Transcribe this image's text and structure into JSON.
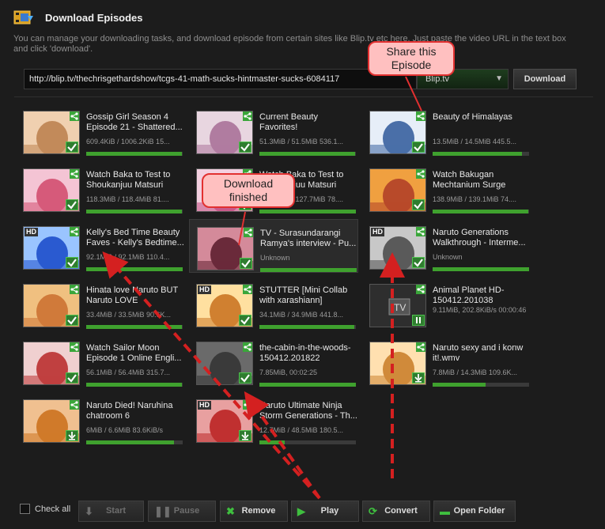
{
  "header": {
    "title": "Download Episodes",
    "description": "You can manage your downloading tasks, and download episode from certain sites like Blip.tv etc here. Just paste the video URL in the text box and click 'download'."
  },
  "url_bar": {
    "value": "http://blip.tv/thechrisgethardshow/tcgs-41-math-sucks-hintmaster-sucks-6084117",
    "site": "Blip.tv",
    "download_label": "Download"
  },
  "callouts": {
    "share": "Share this Episode",
    "finished": "Download finished"
  },
  "episodes": [
    {
      "title": "Gossip Girl Season 4 Episode 21 - Shattered...",
      "info": "609.4KiB / 1006.2KiB 15...",
      "progress": 0.99,
      "status": "finished",
      "hd": false
    },
    {
      "title": "Current Beauty Favorites!",
      "info": "51.3MiB / 51.5MiB 536.1...",
      "progress": 0.99,
      "status": "finished",
      "hd": false
    },
    {
      "title": "Beauty of Himalayas",
      "info": "13.5MiB / 14.5MiB 445.5...",
      "progress": 0.93,
      "status": "finished",
      "hd": false
    },
    {
      "title": "Watch Baka to Test to Shoukanjuu Matsuri Epi...",
      "info": "118.3MiB / 118.4MiB 81....",
      "progress": 0.99,
      "status": "finished",
      "hd": false
    },
    {
      "title": "Watch Baka to Test to Shoukanjuu Matsuri Epi...",
      "info": "127.7MiB / 127.7MiB 78....",
      "progress": 1.0,
      "status": "finished",
      "hd": false
    },
    {
      "title": "Watch Bakugan Mechtanium Surge Epis...",
      "info": "138.9MiB / 139.1MiB 74....",
      "progress": 0.99,
      "status": "finished",
      "hd": false
    },
    {
      "title": "Kelly's Bed Time Beauty Faves - Kelly's Bedtime...",
      "info": "92.1MiB / 92.1MiB 110.4...",
      "progress": 1.0,
      "status": "finished",
      "hd": true
    },
    {
      "title": "TV - Surasundarangi Ramya's interview - Pu...",
      "info": "Unknown",
      "progress": 1.0,
      "status": "finished",
      "hd": false
    },
    {
      "title": "Naruto Generations Walkthrough - Interme...",
      "info": "Unknown",
      "progress": 1.0,
      "status": "finished",
      "hd": true
    },
    {
      "title": "Hinata love Naruto BUT Naruto LOVE SAKURA!...",
      "info": "33.4MiB / 33.5MiB 90.6K...",
      "progress": 0.99,
      "status": "finished",
      "hd": false
    },
    {
      "title": "STUTTER [Mini Collab with xarashiann]",
      "info": "34.1MiB / 34.9MiB 441.8...",
      "progress": 0.98,
      "status": "finished",
      "hd": true
    },
    {
      "title": "Animal Planet HD-150412.201038",
      "info": "9.11MiB, 202.8KiB/s 00:00:46",
      "progress": 0.0,
      "status": "paused",
      "hd": false
    },
    {
      "title": "Watch Sailor Moon Episode 1 Online  Engli...",
      "info": "56.1MiB / 56.4MiB 315.7...",
      "progress": 0.99,
      "status": "finished",
      "hd": false
    },
    {
      "title": "the-cabin-in-the-woods-150412.201822",
      "info": "7.85MiB, 00:02:25",
      "progress": 1.0,
      "status": "finished",
      "hd": false
    },
    {
      "title": "Naruto sexy and i konw it!.wmv",
      "info": "7.8MiB / 14.3MiB 109.6K...",
      "progress": 0.55,
      "status": "downloading",
      "hd": false
    },
    {
      "title": "Naruto Died! Naruhina chatroom 6",
      "info": "6MiB / 6.6MiB 83.6KiB/s",
      "progress": 0.91,
      "status": "downloading",
      "hd": false
    },
    {
      "title": "Naruto Ultimate Ninja Storm Generations - Th...",
      "info": "12.7MiB / 48.5MiB 180.5...",
      "progress": 0.26,
      "status": "downloading",
      "hd": true
    }
  ],
  "toolbar": {
    "check_all": "Check all",
    "start": "Start",
    "pause": "Pause",
    "remove": "Remove",
    "play": "Play",
    "convert": "Convert",
    "open_folder": "Open Folder"
  },
  "colors": {
    "accent_green": "#3fa12e",
    "callout_fill": "#ffc0c0",
    "callout_border": "#e23030",
    "arrow_red": "#d42020"
  }
}
